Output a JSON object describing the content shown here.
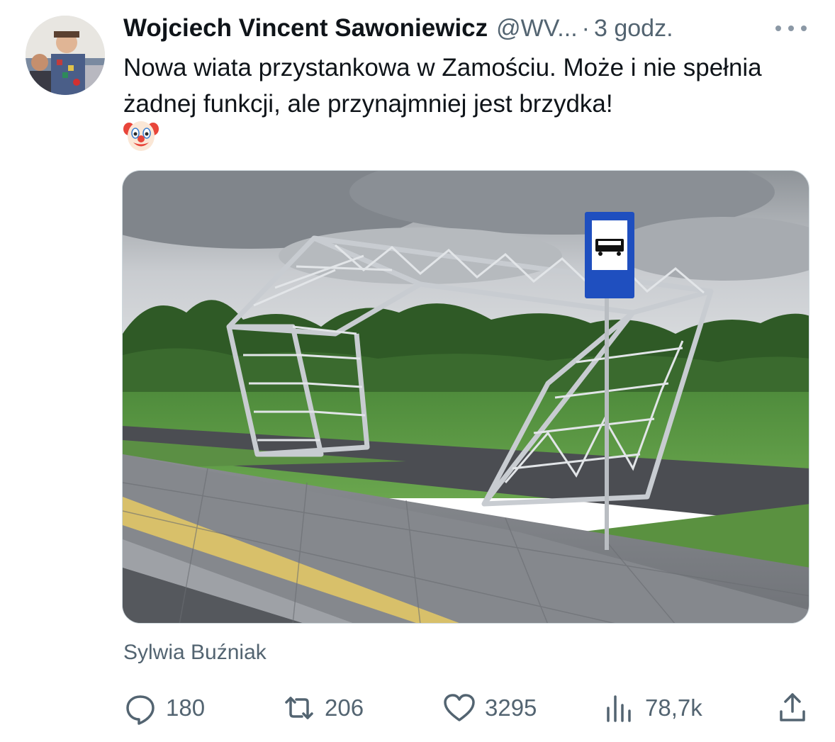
{
  "author": {
    "name": "Wojciech Vincent Sawoniewicz",
    "handle": "@WV...",
    "separator": "·",
    "time": "3 godz."
  },
  "tweet": {
    "text": "Nowa wiata przystankowa w Zamościu. Może i nie spełnia żadnej funkcji, ale przynajmniej jest brzydka!",
    "emoji": "clown-face-emoji"
  },
  "media": {
    "description_icon": "bus-stop-sign-icon",
    "credit": "Sylwia Buźniak"
  },
  "stats": {
    "replies": "180",
    "reposts": "206",
    "likes": "3295",
    "views": "78,7k"
  },
  "colors": {
    "text_primary": "#0f1419",
    "text_secondary": "#536471",
    "sign_blue": "#1f4fbf",
    "tactile_yellow": "#d8c06a"
  }
}
